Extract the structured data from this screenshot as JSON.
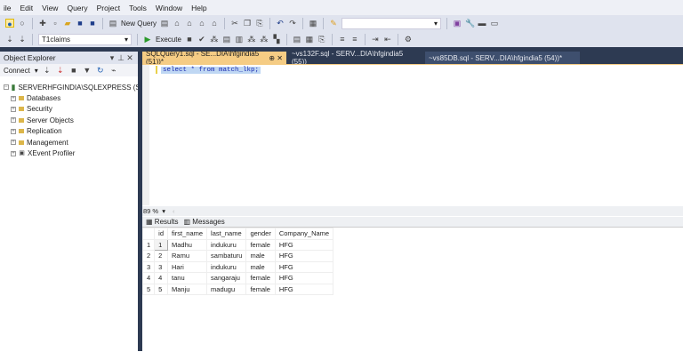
{
  "menu": [
    "ile",
    "Edit",
    "View",
    "Query",
    "Project",
    "Tools",
    "Window",
    "Help"
  ],
  "toolbar": {
    "new_query": "New Query",
    "database": "T1claims",
    "execute": "Execute",
    "search_value": ""
  },
  "object_explorer": {
    "title": "Object Explorer",
    "connect": "Connect",
    "server": "SERVERHFGINDIA\\SQLEXPRESS (SQL Server",
    "nodes": [
      "Databases",
      "Security",
      "Server Objects",
      "Replication",
      "Management",
      "XEvent Profiler"
    ]
  },
  "tabs": [
    "SQLQuery1.sql - SE...DIA\\hfgindia5 (51))*",
    "~vs132F.sql - SERV...DIA\\hfgindia5 (55))",
    "~vs85DB.sql - SERV...DIA\\hfgindia5 (54))*"
  ],
  "editor": {
    "code": "select * from match_lkp;"
  },
  "zoom": "89 %",
  "results": {
    "tabs": [
      "Results",
      "Messages"
    ],
    "columns": [
      "",
      "id",
      "first_name",
      "last_name",
      "gender",
      "Company_Name"
    ],
    "rows": [
      [
        "1",
        "1",
        "Madhu",
        "indukuru",
        "female",
        "HFG"
      ],
      [
        "2",
        "2",
        "Ramu",
        "sambaturu",
        "male",
        "HFG"
      ],
      [
        "3",
        "3",
        "Hari",
        "indukuru",
        "male",
        "HFG"
      ],
      [
        "4",
        "4",
        "tanu",
        "sangaraju",
        "female",
        "HFG"
      ],
      [
        "5",
        "5",
        "Manju",
        "madugu",
        "female",
        "HFG"
      ]
    ]
  }
}
